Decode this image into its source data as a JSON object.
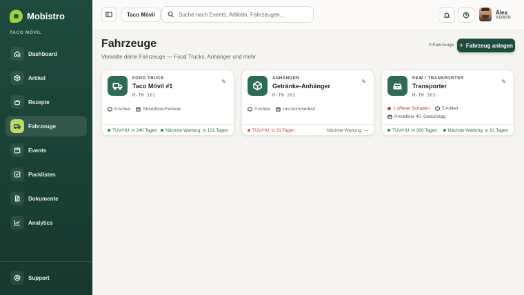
{
  "brand": {
    "name": "Mobistro",
    "tenant_label": "TACO MÓVIL"
  },
  "sidebar": {
    "items": [
      {
        "label": "Dashboard",
        "icon": "home-icon"
      },
      {
        "label": "Artikel",
        "icon": "package-icon"
      },
      {
        "label": "Rezepte",
        "icon": "pot-icon"
      },
      {
        "label": "Fahrzeuge",
        "icon": "truck-icon",
        "active": true
      },
      {
        "label": "Events",
        "icon": "calendar-icon"
      },
      {
        "label": "Packlisten",
        "icon": "checklist-icon"
      },
      {
        "label": "Dokumente",
        "icon": "document-icon"
      },
      {
        "label": "Analytics",
        "icon": "chart-icon"
      }
    ],
    "support_label": "Support"
  },
  "topbar": {
    "tenant": "Taco Móvil",
    "search_placeholder": "Suche nach Events, Artikeln, Fahrzeugen...",
    "user": {
      "name": "Alex",
      "role": "ADMIN"
    }
  },
  "page": {
    "title": "Fahrzeuge",
    "subtitle": "Verwalte deine Fahrzeuge — Food Trucks, Anhänger und mehr.",
    "count": "0 Fahrzeuge",
    "add_button": "Fahrzeug anlegen"
  },
  "vehicles": [
    {
      "type": "FOOD TRUCK",
      "name": "Taco Móvil #1",
      "plate": "M-TM 101",
      "icon": "truck-icon",
      "articles": "8 Artikel",
      "event": "Streetfood-Festival",
      "tuev": "TÜV/HU: in 240 Tagen",
      "service": "Nächste Wartung: in 121 Tagen"
    },
    {
      "type": "ANHÄNGER",
      "name": "Getränke-Anhänger",
      "plate": "M-TM 202",
      "icon": "box-icon",
      "articles": "3 Artikel",
      "event": "Uni-Sommerfest",
      "tuev": "TÜV/HU: in 21 Tagen",
      "service": "Nächste Wartung: —"
    },
    {
      "type": "PKW / TRANSPORTER",
      "name": "Transporter",
      "plate": "M-TM 303",
      "icon": "car-icon",
      "damage": "1 offener Schaden",
      "articles": "5 Artikel",
      "event": "Privatfeier 40. Geburtstag",
      "tuev": "TÜV/HU: in 300 Tagen",
      "service": "Nächste Wartung: in 61 Tagen"
    }
  ]
}
